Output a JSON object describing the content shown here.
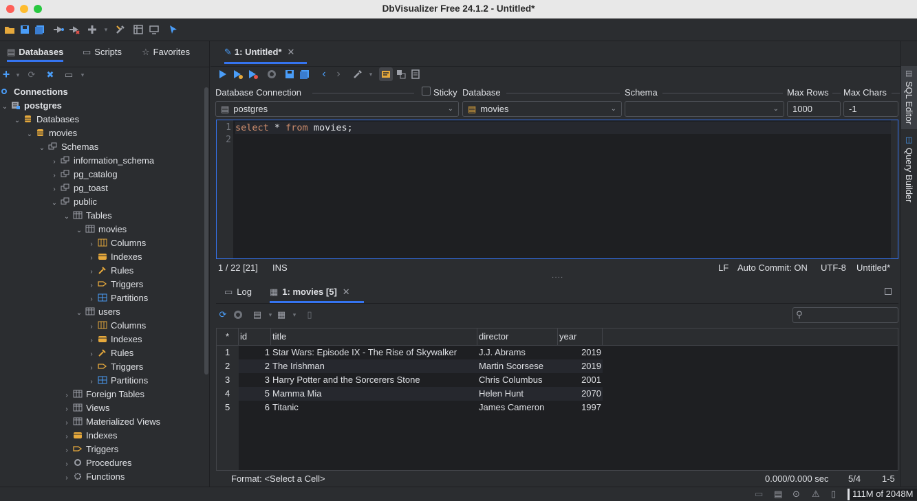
{
  "window": {
    "title": "DbVisualizer Free 24.1.2 - Untitled*"
  },
  "left_tabs": [
    {
      "label": "Databases",
      "active": true
    },
    {
      "label": "Scripts",
      "active": false
    },
    {
      "label": "Favorites",
      "active": false
    }
  ],
  "tree": {
    "connections": "Connections",
    "postgres": "postgres",
    "databases": "Databases",
    "movies_db": "movies",
    "schemas": "Schemas",
    "information_schema": "information_schema",
    "pg_catalog": "pg_catalog",
    "pg_toast": "pg_toast",
    "public": "public",
    "tables": "Tables",
    "movies_table": "movies",
    "movies_children": [
      "Columns",
      "Indexes",
      "Rules",
      "Triggers",
      "Partitions"
    ],
    "users_table": "users",
    "users_children": [
      "Columns",
      "Indexes",
      "Rules",
      "Triggers",
      "Partitions"
    ],
    "foreign_tables": "Foreign Tables",
    "views": "Views",
    "materialized_views": "Materialized Views",
    "indexes": "Indexes",
    "triggers": "Triggers",
    "procedures": "Procedures",
    "functions": "Functions"
  },
  "editor_tab": {
    "label": "1: Untitled*"
  },
  "connection_bar": {
    "db_connection_label": "Database Connection",
    "sticky_label": "Sticky",
    "database_label": "Database",
    "schema_label": "Schema",
    "max_rows_label": "Max Rows",
    "max_chars_label": "Max Chars",
    "connection_value": "postgres",
    "database_value": "movies",
    "schema_value": "",
    "max_rows_value": "1000",
    "max_chars_value": "-1"
  },
  "editor": {
    "line_numbers": [
      "1",
      "2"
    ],
    "kw_select": "select",
    "star": " * ",
    "kw_from": "from",
    "rest": " movies;"
  },
  "editor_status": {
    "position": "1 / 22  [21]",
    "mode": "INS",
    "line_ending": "LF",
    "auto_commit": "Auto Commit: ON",
    "encoding": "UTF-8",
    "file": "Untitled*"
  },
  "result_tabs": [
    {
      "label": "Log",
      "active": false
    },
    {
      "label": "1: movies [5]",
      "active": true
    }
  ],
  "grid": {
    "corner": "*",
    "columns": [
      "id",
      "title",
      "director",
      "year"
    ],
    "rows": [
      {
        "num": "1",
        "id": "1",
        "title": "Star Wars: Episode IX - The Rise of Skywalker",
        "director": "J.J. Abrams",
        "year": "2019"
      },
      {
        "num": "2",
        "id": "2",
        "title": "The Irishman",
        "director": "Martin Scorsese",
        "year": "2019"
      },
      {
        "num": "3",
        "id": "3",
        "title": "Harry Potter and the Sorcerers Stone",
        "director": "Chris Columbus",
        "year": "2001"
      },
      {
        "num": "4",
        "id": "5",
        "title": "Mamma Mia",
        "director": "Helen Hunt",
        "year": "2070"
      },
      {
        "num": "5",
        "id": "6",
        "title": "Titanic",
        "director": "James Cameron",
        "year": "1997"
      }
    ]
  },
  "result_status": {
    "format": "Format: <Select a Cell>",
    "timing": "0.000/0.000 sec",
    "ratio": "5/4",
    "range": "1-5"
  },
  "right_bar": {
    "sql_editor": "SQL Editor",
    "query_builder": "Query Builder"
  },
  "memory": {
    "label": "111M of 2048M"
  },
  "colors": {
    "accent": "#3574f0",
    "run": "#4a9df8",
    "stop": "#e5534b",
    "folder": "#e6a93c"
  }
}
